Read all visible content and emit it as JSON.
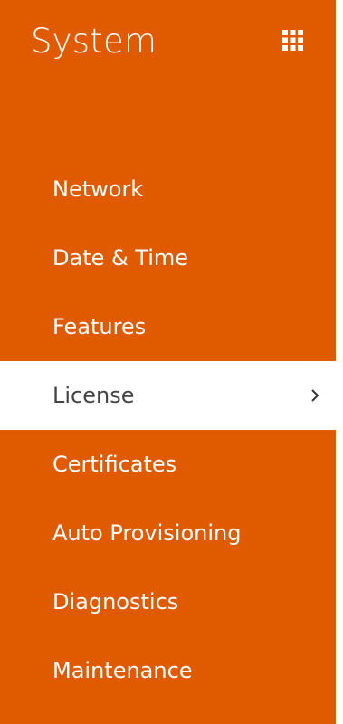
{
  "header": {
    "title": "System",
    "apps_icon": "grid-icon"
  },
  "menu": {
    "items": [
      {
        "label": "Network"
      },
      {
        "label": "Date & Time"
      },
      {
        "label": "Features"
      },
      {
        "label": "License",
        "active": true,
        "indicator": "chevron-right-icon"
      },
      {
        "label": "Certificates"
      },
      {
        "label": "Auto Provisioning"
      },
      {
        "label": "Diagnostics"
      },
      {
        "label": "Maintenance"
      }
    ]
  },
  "colors": {
    "panel_background": "#E05A00",
    "active_background": "#FFFFFF",
    "text": "#FFFFFF",
    "active_text": "#444444"
  }
}
